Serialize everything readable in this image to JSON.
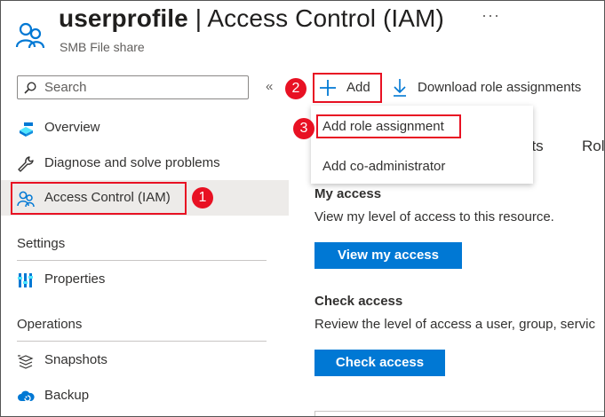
{
  "header": {
    "resource_name": "userprofile",
    "separator": " | ",
    "page_name": "Access Control (IAM)",
    "resource_type": "SMB File share",
    "more_label": "···"
  },
  "sidebar": {
    "search_placeholder": "Search",
    "collapse_label": "«",
    "items_top": [
      {
        "label": "Overview",
        "icon": "overview-icon"
      },
      {
        "label": "Diagnose and solve problems",
        "icon": "wrench-icon"
      },
      {
        "label": "Access Control (IAM)",
        "icon": "people-icon",
        "active": true
      }
    ],
    "settings_heading": "Settings",
    "settings_items": [
      {
        "label": "Properties",
        "icon": "properties-icon"
      }
    ],
    "operations_heading": "Operations",
    "operations_items": [
      {
        "label": "Snapshots",
        "icon": "snapshots-icon"
      },
      {
        "label": "Backup",
        "icon": "backup-icon"
      }
    ]
  },
  "toolbar": {
    "add_label": "Add",
    "download_label": "Download role assignments"
  },
  "add_menu": {
    "items": [
      "Add role assignment",
      "Add co-administrator"
    ]
  },
  "tabs_partial": [
    "nts",
    "Rol"
  ],
  "my_access": {
    "heading": "My access",
    "description": "View my level of access to this resource.",
    "button": "View my access"
  },
  "check_access": {
    "heading": "Check access",
    "description": "Review the level of access a user, group, servic",
    "button": "Check access"
  },
  "callouts": [
    "1",
    "2",
    "3"
  ],
  "colors": {
    "accent": "#0078d4",
    "callout_red": "#e81123",
    "active_nav_bg": "#edebe9"
  }
}
